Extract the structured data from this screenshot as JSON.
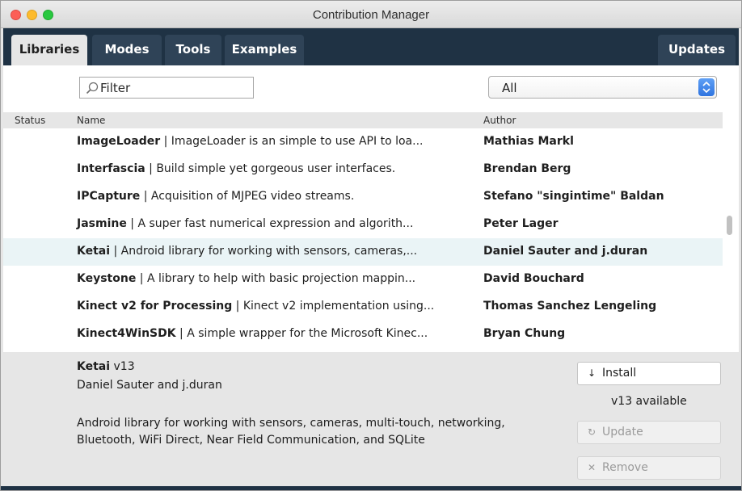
{
  "window": {
    "title": "Contribution Manager"
  },
  "tabs": [
    {
      "label": "Libraries",
      "active": true
    },
    {
      "label": "Modes",
      "active": false
    },
    {
      "label": "Tools",
      "active": false
    },
    {
      "label": "Examples",
      "active": false
    }
  ],
  "updates_tab": {
    "label": "Updates"
  },
  "filter": {
    "value": "Filter",
    "icon": "search-icon"
  },
  "category_select": {
    "value": "All",
    "icon": "updown-arrows-icon"
  },
  "columns": {
    "status": "Status",
    "name": "Name",
    "author": "Author"
  },
  "libraries": [
    {
      "name": "ImageLoader",
      "description": "ImageLoader is an simple to use API to loa...",
      "author": "Mathias Markl"
    },
    {
      "name": "Interfascia",
      "description": "Build simple yet gorgeous user interfaces.",
      "author": "Brendan Berg"
    },
    {
      "name": "IPCapture",
      "description": "Acquisition of MJPEG video streams.",
      "author": "Stefano \"singintime\" Baldan"
    },
    {
      "name": "Jasmine",
      "description": "A super fast numerical expression and algorith...",
      "author": "Peter Lager"
    },
    {
      "name": "Ketai",
      "description": "Android library for working with sensors, cameras,...",
      "author": "Daniel Sauter and j.duran",
      "selected": true
    },
    {
      "name": "Keystone",
      "description": "A library to help with basic projection mappin...",
      "author": "David Bouchard"
    },
    {
      "name": "Kinect v2 for Processing",
      "description": "Kinect v2 implementation using...",
      "author": "Thomas Sanchez Lengeling"
    },
    {
      "name": "Kinect4WinSDK",
      "description": "A simple wrapper for the Microsoft Kinec...",
      "author": "Bryan Chung"
    }
  ],
  "details": {
    "name": "Ketai",
    "version": "v13",
    "author": "Daniel Sauter and j.duran",
    "description": "Android library for working with sensors, cameras, multi-touch, networking, Bluetooth, WiFi Direct, Near Field Communication, and SQLite",
    "available": "v13 available"
  },
  "buttons": {
    "install": {
      "label": "Install",
      "icon": "↓"
    },
    "update": {
      "label": "Update",
      "icon": "↻"
    },
    "remove": {
      "label": "Remove",
      "icon": "✕"
    }
  },
  "colors": {
    "tabbar": "#1f3244",
    "tab": "#2f4357",
    "selected_row": "#eaf4f6",
    "panel": "#e6e6e6",
    "select_arrow": "#3f82ea"
  }
}
